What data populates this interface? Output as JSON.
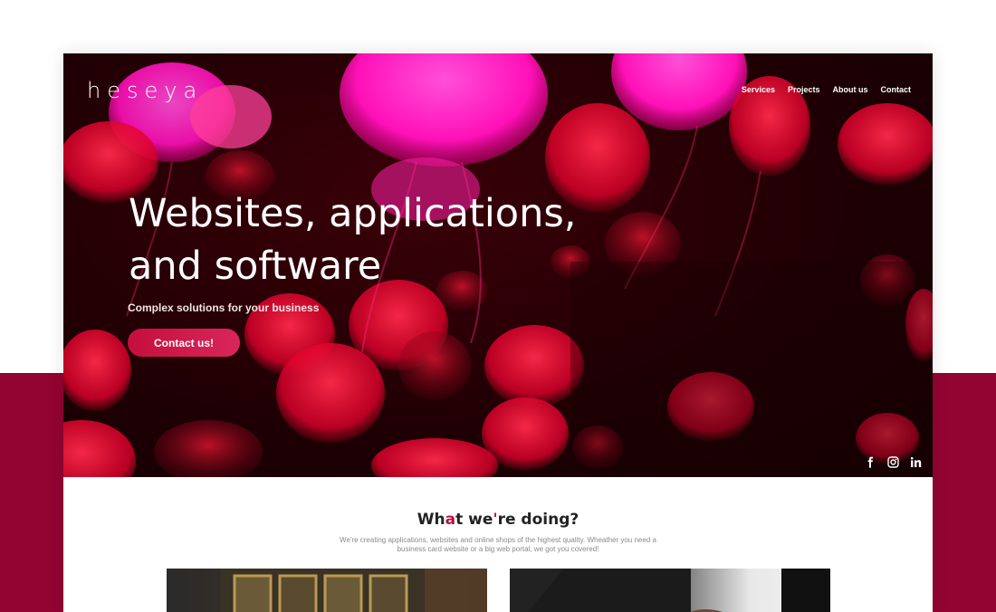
{
  "brand": {
    "logo": "heseya"
  },
  "nav": {
    "items": [
      "Services",
      "Projects",
      "About us",
      "Contact"
    ]
  },
  "hero": {
    "title": "Websites, applications, and software",
    "subtitle": "Complex solutions for your business",
    "cta_label": "Contact us!"
  },
  "social": {
    "icons": [
      "facebook-icon",
      "instagram-icon",
      "linkedin-icon"
    ]
  },
  "section": {
    "title_start": "Wh",
    "title_accent": "a",
    "title_mid": "t we",
    "title_accent2": "'",
    "title_end": "re doing?",
    "description": "We're creating applications, websites and online shops of the highest quality. Wheather you need a business card website or a big web portal, we got you covered!"
  },
  "colors": {
    "brand_red": "#930432",
    "accent": "#b5123c",
    "cta": "#c40f3d"
  }
}
